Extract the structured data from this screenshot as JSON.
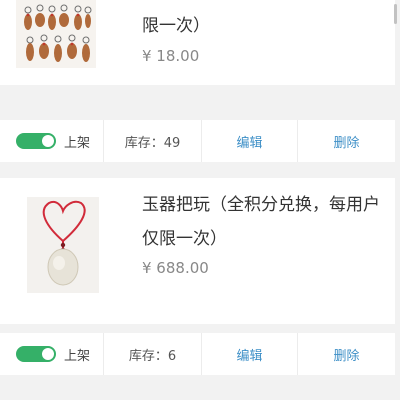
{
  "products": [
    {
      "image_icon": "keychains-image",
      "title_lines": [
        "限一次）"
      ],
      "price": "¥ 18.00",
      "listed_label": "上架",
      "listed_on": true,
      "stock": "库存：49",
      "edit_label": "编辑",
      "delete_label": "删除"
    },
    {
      "image_icon": "jade-pendant-image",
      "title_lines": [
        "玉器把玩（全积分兑换，每用户",
        "仅限一次）"
      ],
      "price": "¥ 688.00",
      "listed_label": "上架",
      "listed_on": true,
      "stock": "库存：6",
      "edit_label": "编辑",
      "delete_label": "删除"
    }
  ],
  "colors": {
    "accent": "#3d8fc7",
    "toggle_on": "#35b068",
    "background": "#f2f2f2"
  }
}
